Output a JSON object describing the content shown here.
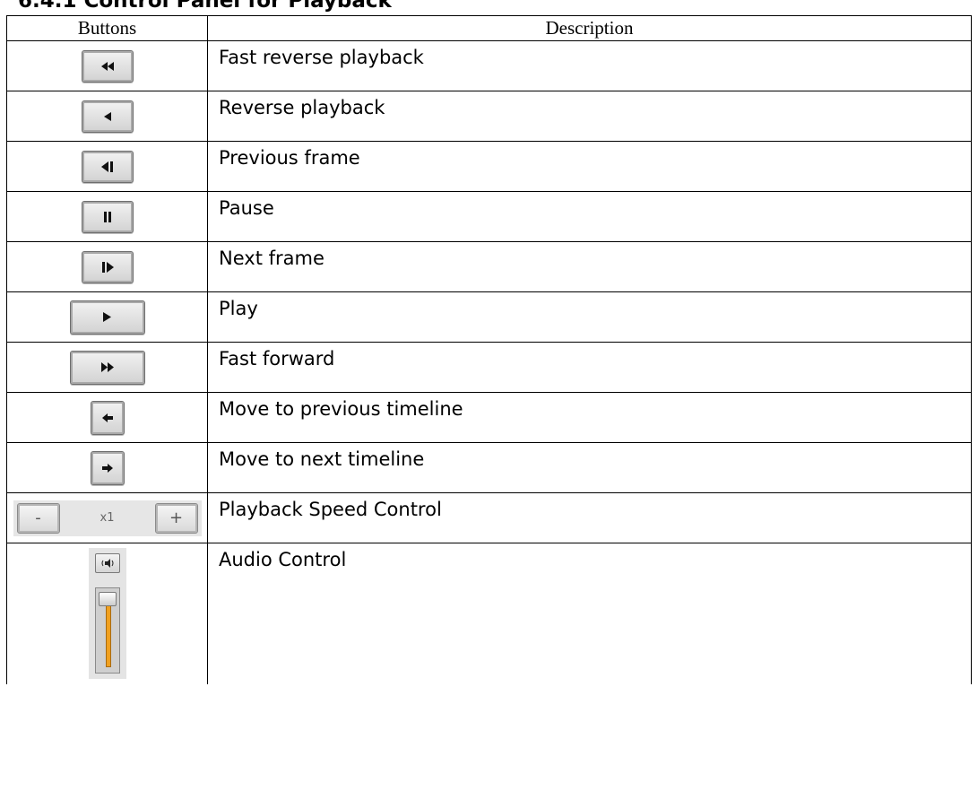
{
  "section_title": "6.4.1 Control Panel for Playback",
  "table": {
    "headers": [
      "Buttons",
      "Description"
    ],
    "rows": [
      {
        "icon": "fast-reverse-icon",
        "description": "Fast reverse playback"
      },
      {
        "icon": "reverse-play-icon",
        "description": "Reverse playback"
      },
      {
        "icon": "previous-frame-icon",
        "description": "Previous frame"
      },
      {
        "icon": "pause-icon",
        "description": "Pause"
      },
      {
        "icon": "next-frame-icon",
        "description": "Next frame"
      },
      {
        "icon": "play-icon",
        "description": "Play"
      },
      {
        "icon": "fast-forward-icon",
        "description": "Fast forward"
      },
      {
        "icon": "previous-timeline-icon",
        "description": "Move to previous timeline"
      },
      {
        "icon": "next-timeline-icon",
        "description": "Move to next timeline"
      },
      {
        "icon": "speed-control-icon",
        "description": "Playback Speed Control"
      },
      {
        "icon": "audio-control-icon",
        "description": "Audio Control"
      }
    ]
  },
  "speed_control": {
    "minus_label": "-",
    "value": "x1",
    "plus_label": "+"
  }
}
